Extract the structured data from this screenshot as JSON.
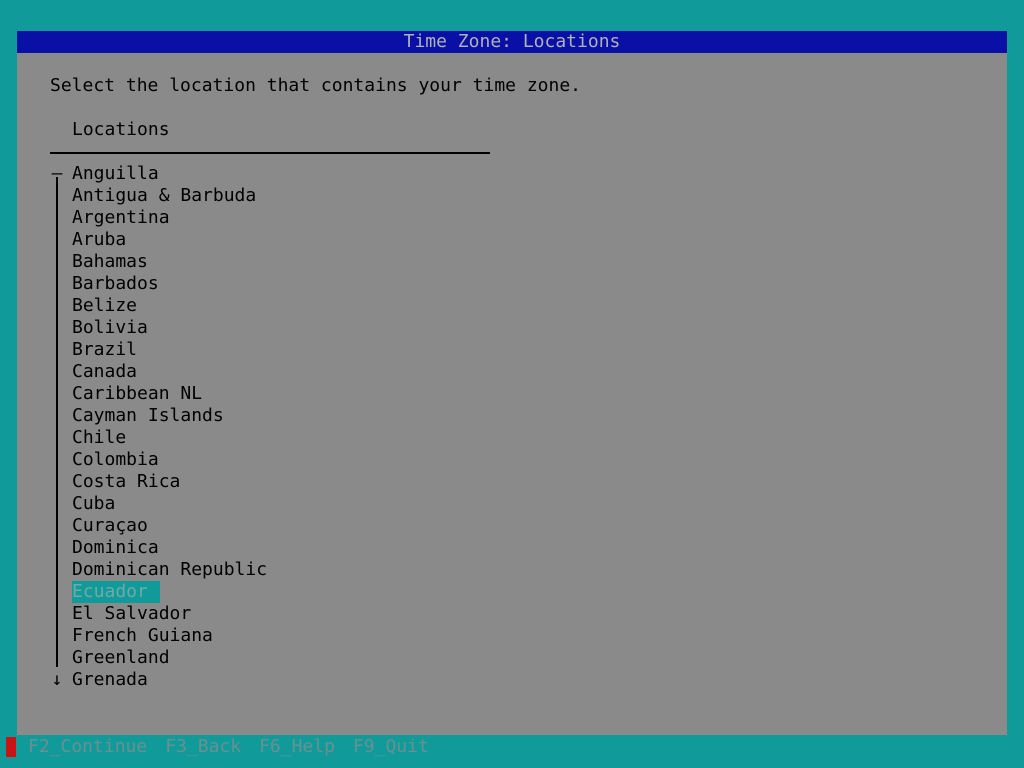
{
  "window": {
    "title": "Time Zone: Locations"
  },
  "prompt": "Select the location that contains your time zone.",
  "list": {
    "header": "Locations",
    "top_marker": "—",
    "bottom_marker": "↓",
    "selected_index": 19,
    "items": [
      "Anguilla",
      "Antigua & Barbuda",
      "Argentina",
      "Aruba",
      "Bahamas",
      "Barbados",
      "Belize",
      "Bolivia",
      "Brazil",
      "Canada",
      "Caribbean NL",
      "Cayman Islands",
      "Chile",
      "Colombia",
      "Costa Rica",
      "Cuba",
      "Curaçao",
      "Dominica",
      "Dominican Republic",
      "Ecuador",
      "El Salvador",
      "French Guiana",
      "Greenland",
      "Grenada"
    ]
  },
  "footer": {
    "keys": [
      "F2_Continue",
      "F3_Back",
      "F6_Help",
      "F9_Quit"
    ]
  },
  "colors": {
    "background": "#119a9a",
    "panel": "#8a8a8a",
    "titlebar": "#0a10a6",
    "selection": "#119a9a"
  }
}
